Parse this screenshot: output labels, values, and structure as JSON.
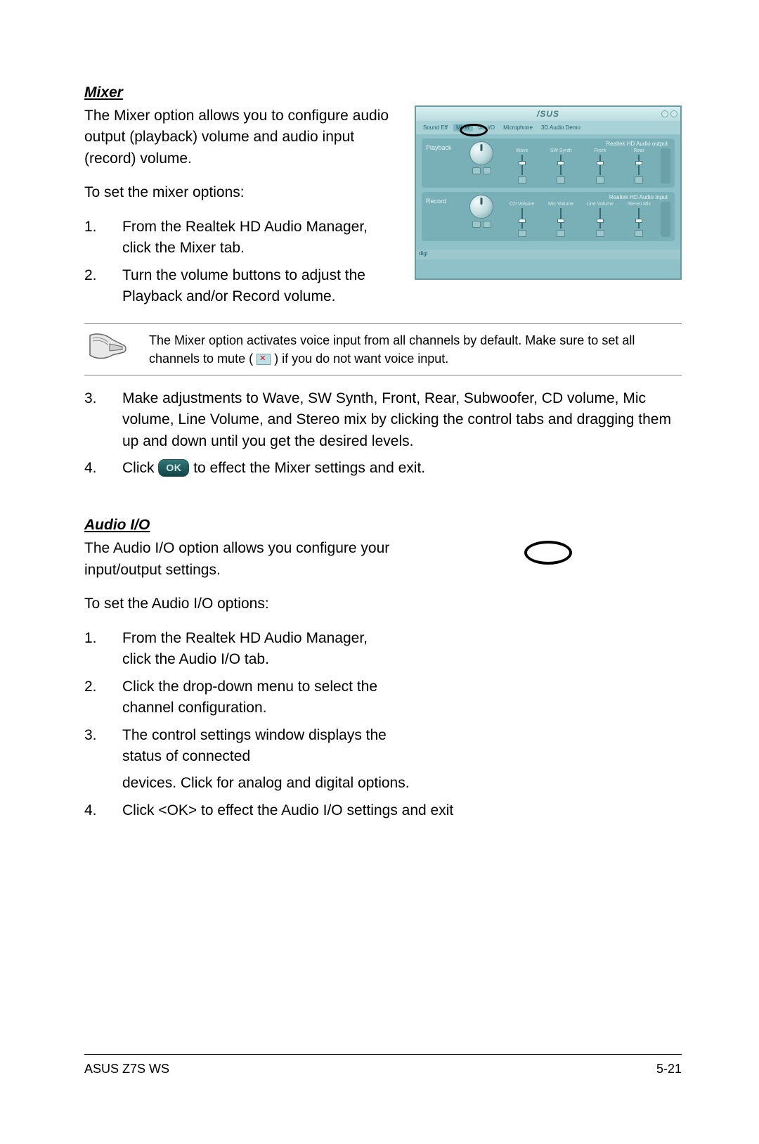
{
  "section_mixer": {
    "title": "Mixer",
    "intro": "The Mixer option allows you to configure audio output (playback) volume and audio input (record) volume.",
    "preamble": "To set the mixer options:",
    "steps12": [
      {
        "n": "1.",
        "t": "From the Realtek HD Audio Manager, click the Mixer tab."
      },
      {
        "n": "2.",
        "t": "Turn the volume buttons to adjust the Playback and/or Record volume."
      }
    ],
    "note_a": "The Mixer option activates voice input from all channels by default. Make sure to set all channels to mute (",
    "note_b": ") if you do not want voice input.",
    "steps34": {
      "s3": {
        "n": "3.",
        "t": "Make adjustments to Wave, SW Synth, Front, Rear, Subwoofer, CD volume, Mic volume, Line Volume, and Stereo mix by clicking the control tabs and dragging them up and down until you get the desired levels."
      },
      "s4": {
        "n": "4.",
        "a": "Click ",
        "ok": "OK",
        "b": " to effect the Mixer settings and exit."
      }
    }
  },
  "section_audio": {
    "title": "Audio I/O",
    "intro": "The Audio I/O option allows you configure your input/output settings.",
    "preamble": "To set the Audio I/O options:",
    "steps": [
      {
        "n": "1.",
        "t": "From the Realtek HD Audio Manager, click the Audio I/O tab."
      },
      {
        "n": "2.",
        "t": "Click the drop-down menu to select the channel configuration."
      },
      {
        "n": "3.",
        "t": "The control settings window displays the status of connected"
      }
    ],
    "step3b": "devices. Click        for analog and digital options.",
    "step4": {
      "n": "4.",
      "t": "Click <OK> to effect the Audio I/O settings and exit"
    }
  },
  "screenshot": {
    "logo": "/SUS",
    "tabs": [
      "Sound Eff",
      "Mixer",
      "dio I/O",
      "Microphone",
      "3D Audio Demo"
    ],
    "playback_label": "Playback",
    "record_label": "Record",
    "playback_title": "Realtek HD Audio output",
    "record_title": "Realtek HD Audio Input",
    "playback_cols": [
      "Wave",
      "SW Synth",
      "Front",
      "Rear"
    ],
    "record_cols": [
      "CD Volume",
      "Mic Volume",
      "Line Volume",
      "Stereo Mix"
    ],
    "status": "digi"
  },
  "footer": {
    "left": "ASUS Z7S WS",
    "right": "5-21"
  }
}
